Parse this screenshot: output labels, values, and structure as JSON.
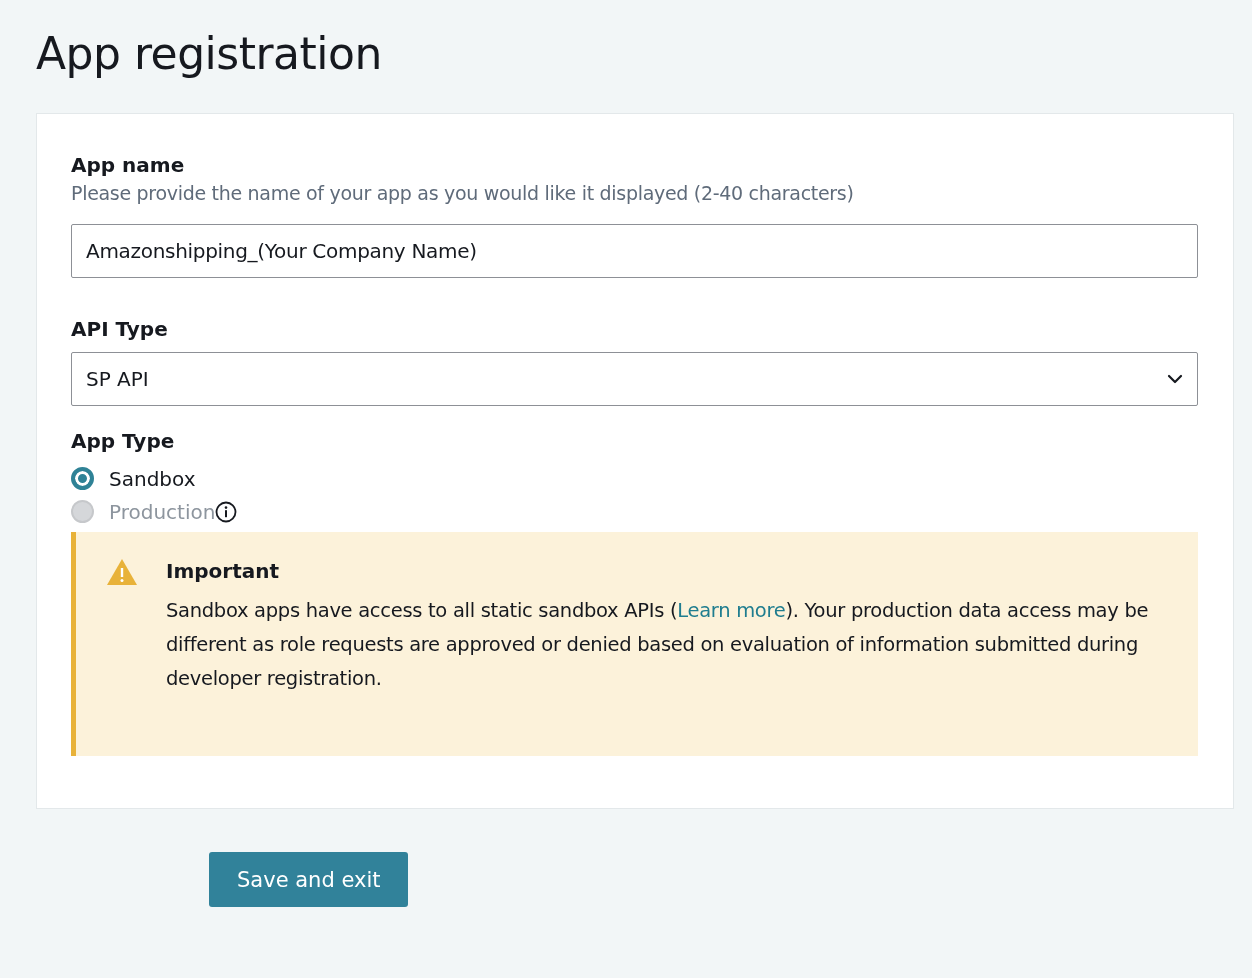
{
  "title": "App registration",
  "app_name": {
    "label": "App name",
    "hint": "Please provide the name of your app as you would like it displayed (2-40 characters)",
    "value": "Amazonshipping_(Your Company Name)"
  },
  "api_type": {
    "label": "API Type",
    "value": "SP API"
  },
  "app_type": {
    "label": "App Type",
    "options": [
      {
        "label": "Sandbox",
        "selected": true,
        "disabled": false,
        "info": false
      },
      {
        "label": "Production",
        "selected": false,
        "disabled": true,
        "info": true
      }
    ]
  },
  "notice": {
    "title": "Important",
    "text_before": "Sandbox apps have access to all static sandbox APIs (",
    "link": "Learn more",
    "text_after": "). Your production data access may be different as role requests are approved or denied based on evaluation of information submitted during developer registration."
  },
  "save_button": "Save and exit"
}
